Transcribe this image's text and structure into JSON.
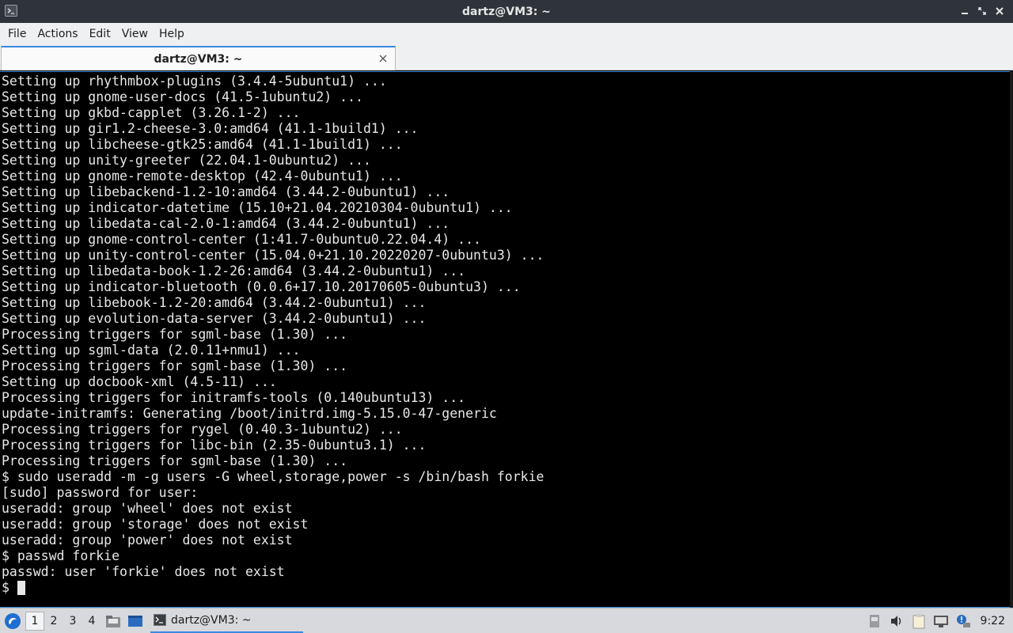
{
  "window": {
    "title": "dartz@VM3: ~",
    "icon": "terminal-icon"
  },
  "menubar": {
    "items": [
      "File",
      "Actions",
      "Edit",
      "View",
      "Help"
    ]
  },
  "tab": {
    "label": "dartz@VM3: ~"
  },
  "terminal": {
    "lines": [
      "Setting up rhythmbox-plugins (3.4.4-5ubuntu1) ...",
      "Setting up gnome-user-docs (41.5-1ubuntu2) ...",
      "Setting up gkbd-capplet (3.26.1-2) ...",
      "Setting up gir1.2-cheese-3.0:amd64 (41.1-1build1) ...",
      "Setting up libcheese-gtk25:amd64 (41.1-1build1) ...",
      "Setting up unity-greeter (22.04.1-0ubuntu2) ...",
      "Setting up gnome-remote-desktop (42.4-0ubuntu1) ...",
      "Setting up libebackend-1.2-10:amd64 (3.44.2-0ubuntu1) ...",
      "Setting up indicator-datetime (15.10+21.04.20210304-0ubuntu1) ...",
      "Setting up libedata-cal-2.0-1:amd64 (3.44.2-0ubuntu1) ...",
      "Setting up gnome-control-center (1:41.7-0ubuntu0.22.04.4) ...",
      "Setting up unity-control-center (15.04.0+21.10.20220207-0ubuntu3) ...",
      "Setting up libedata-book-1.2-26:amd64 (3.44.2-0ubuntu1) ...",
      "Setting up indicator-bluetooth (0.0.6+17.10.20170605-0ubuntu3) ...",
      "Setting up libebook-1.2-20:amd64 (3.44.2-0ubuntu1) ...",
      "Setting up evolution-data-server (3.44.2-0ubuntu1) ...",
      "Processing triggers for sgml-base (1.30) ...",
      "Setting up sgml-data (2.0.11+nmu1) ...",
      "Processing triggers for sgml-base (1.30) ...",
      "Setting up docbook-xml (4.5-11) ...",
      "Processing triggers for initramfs-tools (0.140ubuntu13) ...",
      "update-initramfs: Generating /boot/initrd.img-5.15.0-47-generic",
      "Processing triggers for rygel (0.40.3-1ubuntu2) ...",
      "Processing triggers for libc-bin (2.35-0ubuntu3.1) ...",
      "Processing triggers for sgml-base (1.30) ...",
      "$ sudo useradd -m -g users -G wheel,storage,power -s /bin/bash forkie",
      "[sudo] password for user:",
      "useradd: group 'wheel' does not exist",
      "useradd: group 'storage' does not exist",
      "useradd: group 'power' does not exist",
      "$ passwd forkie",
      "passwd: user 'forkie' does not exist"
    ],
    "prompt": "$ "
  },
  "taskbar": {
    "workspaces": [
      "1",
      "2",
      "3",
      "4"
    ],
    "active_workspace": "1",
    "task_label": "dartz@VM3: ~",
    "clock": "9:22"
  },
  "colors": {
    "accent": "#3b8ae0",
    "titlebar_bg": "#2f343a",
    "terminal_bg": "#000000",
    "terminal_fg": "#e8e8e8"
  }
}
